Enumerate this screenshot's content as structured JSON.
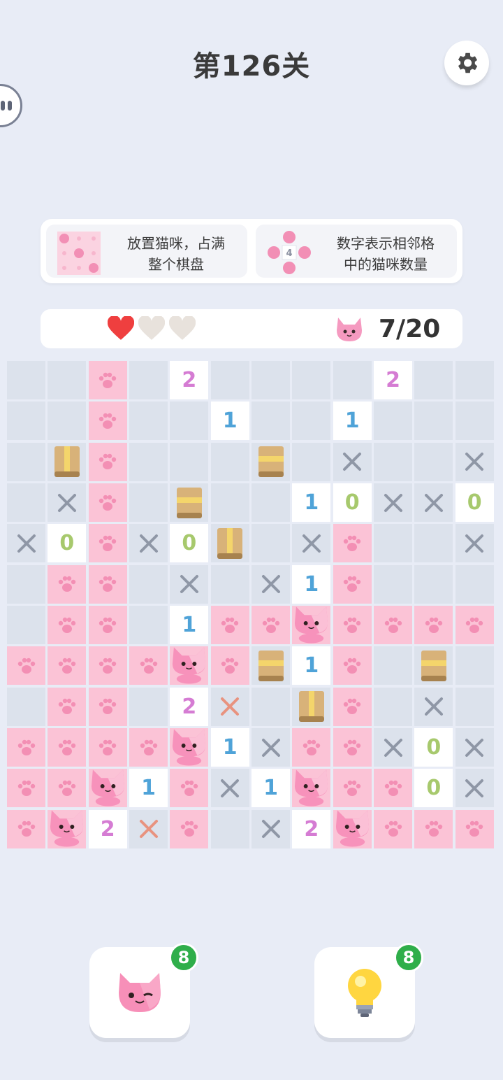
{
  "header": {
    "title": "第126关"
  },
  "rules": [
    {
      "text_line1": "放置猫咪，占满",
      "text_line2": "整个棋盘"
    },
    {
      "text_line1": "数字表示相邻格",
      "text_line2": "中的猫咪数量",
      "example_number": "4"
    }
  ],
  "status": {
    "lives_total": 3,
    "lives_remaining": 1,
    "cats_placed": "7/20"
  },
  "board": {
    "size": 12,
    "rows": [
      [
        "e",
        "e",
        "p",
        "e",
        "2",
        "e",
        "e",
        "e",
        "e",
        "2",
        "e",
        "e"
      ],
      [
        "e",
        "e",
        "p",
        "e",
        "e",
        "1",
        "e",
        "e",
        "1",
        "e",
        "e",
        "e"
      ],
      [
        "e",
        "B",
        "p",
        "e",
        "e",
        "e",
        "b",
        "e",
        "x",
        "e",
        "e",
        "x"
      ],
      [
        "e",
        "x",
        "p",
        "e",
        "b",
        "e",
        "e",
        "1",
        "0",
        "x",
        "x",
        "0"
      ],
      [
        "x",
        "0",
        "p",
        "x",
        "0",
        "B",
        "e",
        "x",
        "p",
        "e",
        "e",
        "x"
      ],
      [
        "e",
        "p",
        "p",
        "e",
        "x",
        "e",
        "x",
        "1",
        "p",
        "e",
        "e",
        "e"
      ],
      [
        "e",
        "p",
        "p",
        "e",
        "1",
        "p",
        "p",
        "C",
        "p",
        "p",
        "p",
        "p"
      ],
      [
        "p",
        "p",
        "p",
        "p",
        "C",
        "p",
        "b",
        "1",
        "p",
        "e",
        "b",
        "e"
      ],
      [
        "e",
        "p",
        "p",
        "e",
        "2",
        "r",
        "e",
        "B",
        "p",
        "e",
        "x",
        "e"
      ],
      [
        "p",
        "p",
        "p",
        "p",
        "C",
        "1",
        "x",
        "p",
        "p",
        "x",
        "0",
        "x"
      ],
      [
        "p",
        "p",
        "C",
        "1",
        "p",
        "x",
        "1",
        "C",
        "p",
        "p",
        "0",
        "x"
      ],
      [
        "p",
        "C",
        "2",
        "r",
        "p",
        "e",
        "x",
        "2",
        "C",
        "p",
        "p",
        "p"
      ]
    ]
  },
  "tools": {
    "cat_hint_count": "8",
    "bulb_hint_count": "8"
  },
  "colors": {
    "background": "#e8ecf6",
    "cell_empty": "#dce2ec",
    "cell_cat": "#fbc3d6",
    "number_1": "#4fa3d8",
    "number_2": "#d57cd3",
    "number_0": "#a7c96d",
    "badge": "#2fae4a"
  }
}
